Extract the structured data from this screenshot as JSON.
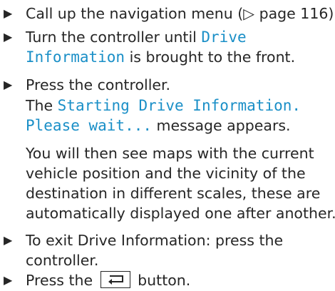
{
  "steps": [
    {
      "text_a": "Call up the navigation menu (",
      "page_glyph": "▷",
      "text_b": " page 116)."
    },
    {
      "text_a": "Turn the controller until ",
      "highlight_a": "Drive",
      "highlight_b": "Information",
      "text_b": " is brought to the front."
    },
    {
      "text_a": "Press the controller.",
      "text_b": "The ",
      "highlight_a": "Starting Drive Information.",
      "highlight_b": "Please wait...",
      "text_c": " message appears."
    },
    {
      "para_1": "You will then see maps with the current",
      "para_2": "vehicle position and the vicinity of the",
      "para_3": "destination in different scales, these are",
      "para_4": "automatically displayed one after another."
    },
    {
      "text_a": "To exit Drive Information: press the",
      "text_b": "controller."
    },
    {
      "text_a": "Press the ",
      "button_icon": "back-arrow-icon",
      "text_b": " button."
    }
  ]
}
